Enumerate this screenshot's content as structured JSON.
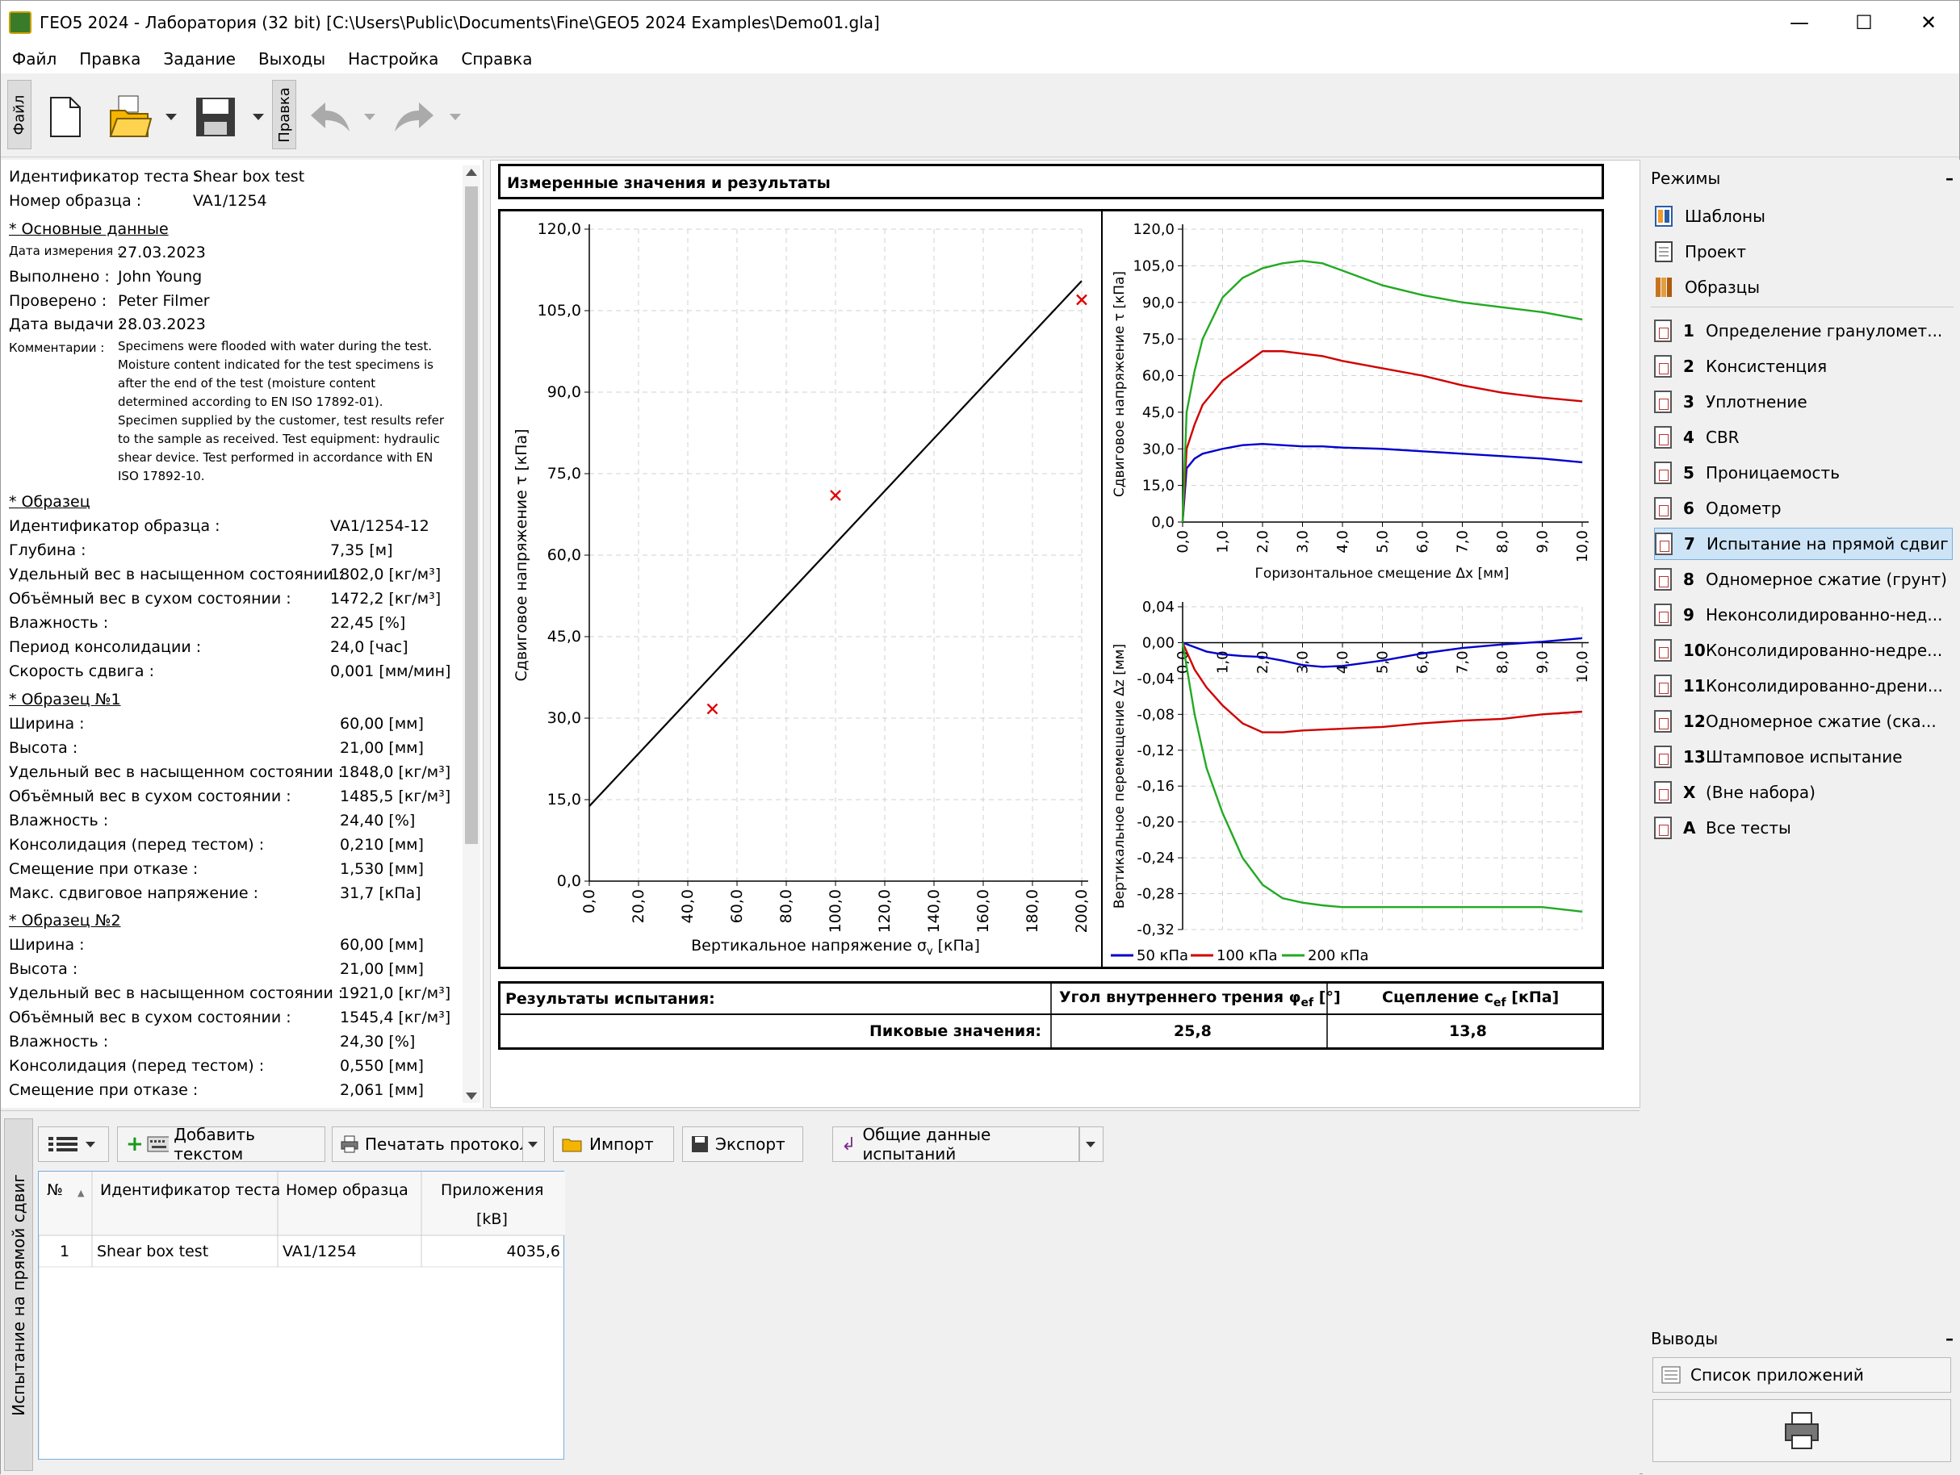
{
  "window": {
    "title": "ГЕО5 2024 - Лаборатория (32 bit) [C:\\Users\\Public\\Documents\\Fine\\GEO5 2024 Examples\\Demo01.gla]",
    "minimize": "—",
    "maximize": "☐",
    "close": "✕"
  },
  "menu": [
    "Файл",
    "Правка",
    "Задание",
    "Выходы",
    "Настройка",
    "Справка"
  ],
  "toolbar": {
    "tab_file": "Файл",
    "tab_edit": "Правка"
  },
  "left_panel": {
    "test_id_label": "Идентификатор теста :",
    "test_id_value": "Shear box test",
    "sample_no_label": "Номер образца :",
    "sample_no_value": "VA1/1254",
    "basic_section": "* Основные данные",
    "measure_date_label": "Дата измерения :",
    "measure_date_value": "27.03.2023",
    "performed_label": "Выполнено :",
    "performed_value": "John Young",
    "checked_label": "Проверено :",
    "checked_value": "Peter Filmer",
    "issue_date_label": "Дата выдачи :",
    "issue_date_value": "28.03.2023",
    "comments_label": "Комментарии :",
    "comments_lines": [
      "Specimens were flooded with water during the test.",
      "Moisture content indicated for the test specimens is",
      "after the end of the test (moisture content",
      "determined according to EN ISO 17892-01).",
      "Specimen supplied by the customer, test results refer",
      "to the sample as received. Test equipment: hydraulic",
      "shear device. Test performed in accordance with EN",
      "ISO 17892-10."
    ],
    "sample_section": "* Образец",
    "sample_rows": [
      {
        "label": "Идентификатор образца :",
        "value": "VA1/1254-12"
      },
      {
        "label": "Глубина :",
        "value": "7,35 [м]"
      },
      {
        "label": "Удельный вес в насыщенном состоянии :",
        "value": "1802,0 [кг/м³]"
      },
      {
        "label": "Объёмный вес в сухом состоянии :",
        "value": "1472,2 [кг/м³]"
      },
      {
        "label": "Влажность :",
        "value": "22,45 [%]"
      },
      {
        "label": "Период консолидации :",
        "value": "24,0 [час]"
      },
      {
        "label": "Скорость сдвига :",
        "value": "0,001 [мм/мин]"
      }
    ],
    "spec1_section": "* Образец №1",
    "spec1_rows": [
      {
        "label": "Ширина :",
        "value": "60,00 [мм]"
      },
      {
        "label": "Высота :",
        "value": "21,00 [мм]"
      },
      {
        "label": "Удельный вес в насыщенном состоянии :",
        "value": "1848,0 [кг/м³]"
      },
      {
        "label": "Объёмный вес в сухом состоянии :",
        "value": "1485,5 [кг/м³]"
      },
      {
        "label": "Влажность :",
        "value": "24,40 [%]"
      },
      {
        "label": "Консолидация (перед тестом) :",
        "value": "0,210 [мм]"
      },
      {
        "label": "Смещение при отказе :",
        "value": "1,530 [мм]"
      },
      {
        "label": "Макс. сдвиговое напряжение :",
        "value": "31,7 [кПа]"
      }
    ],
    "spec2_section": "* Образец №2",
    "spec2_rows": [
      {
        "label": "Ширина :",
        "value": "60,00 [мм]"
      },
      {
        "label": "Высота :",
        "value": "21,00 [мм]"
      },
      {
        "label": "Удельный вес в насыщенном состоянии :",
        "value": "1921,0 [кг/м³]"
      },
      {
        "label": "Объёмный вес в сухом состоянии :",
        "value": "1545,4 [кг/м³]"
      },
      {
        "label": "Влажность :",
        "value": "24,30 [%]"
      },
      {
        "label": "Консолидация (перед тестом) :",
        "value": "0,550 [мм]"
      },
      {
        "label": "Смещение при отказе :",
        "value": "2,061 [мм]"
      }
    ]
  },
  "center": {
    "header": "Измеренные значения и результаты",
    "results": {
      "title": "Результаты испытания:",
      "phi_label": "Угол внутреннего трения φ",
      "phi_sub": "ef",
      "phi_unit": " [°]",
      "c_label": "Сцепление c",
      "c_sub": "ef",
      "c_unit": " [кПа]",
      "peak_label": "Пиковые значения:",
      "phi_value": "25,8",
      "c_value": "13,8"
    }
  },
  "chart_data": [
    {
      "type": "scatter",
      "xlabel": "Вертикальное напряжение σ",
      "xlabel_sub": "v",
      "xlabel_unit": " [кПа]",
      "ylabel": "Сдвиговое напряжение τ [кПа]",
      "xlim": [
        0,
        200
      ],
      "ylim": [
        0,
        120
      ],
      "x_ticks": [
        "0,0",
        "20,0",
        "40,0",
        "60,0",
        "80,0",
        "100,0",
        "120,0",
        "140,0",
        "160,0",
        "180,0",
        "200,0"
      ],
      "y_ticks": [
        "0,0",
        "15,0",
        "30,0",
        "45,0",
        "60,0",
        "75,0",
        "90,0",
        "105,0",
        "120,0"
      ],
      "points": [
        {
          "x": 50,
          "y": 31.7
        },
        {
          "x": 100,
          "y": 71
        },
        {
          "x": 200,
          "y": 107
        }
      ],
      "fit_line": {
        "c": 13.8,
        "phi": 25.8
      },
      "marker_color": "#e00000",
      "line_color": "#000000"
    },
    {
      "type": "line",
      "xlabel": "Горизонтальное смещение Δx [мм]",
      "ylabel": "Сдвиговое напряжение τ [кПа]",
      "xlim": [
        0,
        10
      ],
      "ylim": [
        0,
        120
      ],
      "x_ticks": [
        "0,0",
        "1,0",
        "2,0",
        "3,0",
        "4,0",
        "5,0",
        "6,0",
        "7,0",
        "8,0",
        "9,0",
        "10,0"
      ],
      "y_ticks": [
        "0,0",
        "15,0",
        "30,0",
        "45,0",
        "60,0",
        "75,0",
        "90,0",
        "105,0",
        "120,0"
      ],
      "x": [
        0,
        0.1,
        0.3,
        0.5,
        1,
        1.5,
        2,
        2.5,
        3,
        3.5,
        4,
        5,
        6,
        7,
        8,
        9,
        10
      ],
      "series": [
        {
          "name": "50 кПа",
          "color": "#0000cc",
          "values": [
            0,
            22,
            26,
            28,
            30,
            31.5,
            32,
            31.5,
            31,
            31,
            30.5,
            30,
            29,
            28,
            27,
            26,
            24.5
          ]
        },
        {
          "name": "100 кПа",
          "color": "#d00000",
          "values": [
            0,
            30,
            40,
            48,
            58,
            64,
            70,
            70,
            69,
            68,
            66,
            63,
            60,
            56,
            53,
            51,
            49.5
          ]
        },
        {
          "name": "200 кПа",
          "color": "#22aa22",
          "values": [
            0,
            45,
            62,
            75,
            92,
            100,
            104,
            106,
            107,
            106,
            103,
            97,
            93,
            90,
            88,
            86,
            83
          ]
        }
      ]
    },
    {
      "type": "line",
      "xlabel": "",
      "ylabel": "Вертикальное перемещение Δz [мм]",
      "xlim": [
        0,
        10
      ],
      "ylim": [
        -0.32,
        0.04
      ],
      "x_ticks": [
        "0,0",
        "1,0",
        "2,0",
        "3,0",
        "4,0",
        "5,0",
        "6,0",
        "7,0",
        "8,0",
        "9,0",
        "10,0"
      ],
      "y_ticks": [
        "0,04",
        "0,00",
        "-0,04",
        "-0,08",
        "-0,12",
        "-0,16",
        "-0,20",
        "-0,24",
        "-0,28",
        "-0,32"
      ],
      "x": [
        0,
        0.3,
        0.6,
        1,
        1.5,
        2,
        2.5,
        3,
        3.5,
        4,
        5,
        6,
        7,
        8,
        9,
        10
      ],
      "series": [
        {
          "name": "50 кПа",
          "color": "#0000cc",
          "values": [
            0,
            -0.005,
            -0.01,
            -0.013,
            -0.015,
            -0.016,
            -0.02,
            -0.025,
            -0.027,
            -0.026,
            -0.02,
            -0.012,
            -0.006,
            -0.002,
            0.001,
            0.005
          ]
        },
        {
          "name": "100 кПа",
          "color": "#d00000",
          "values": [
            0,
            -0.03,
            -0.05,
            -0.07,
            -0.09,
            -0.1,
            -0.1,
            -0.098,
            -0.097,
            -0.096,
            -0.094,
            -0.09,
            -0.087,
            -0.085,
            -0.08,
            -0.077
          ]
        },
        {
          "name": "200 кПа",
          "color": "#22aa22",
          "values": [
            0,
            -0.08,
            -0.14,
            -0.19,
            -0.24,
            -0.27,
            -0.285,
            -0.29,
            -0.293,
            -0.295,
            -0.295,
            -0.295,
            -0.295,
            -0.295,
            -0.295,
            -0.3
          ]
        }
      ],
      "legend": [
        "50 кПа",
        "100 кПа",
        "200 кПа"
      ]
    }
  ],
  "right_panel": {
    "modes_title": "Режимы",
    "collapse": "–",
    "top_items": [
      "Шаблоны",
      "Проект",
      "Образцы"
    ],
    "tests": [
      {
        "num": "1",
        "label": "Определение грануломет..."
      },
      {
        "num": "2",
        "label": "Консистенция"
      },
      {
        "num": "3",
        "label": "Уплотнение"
      },
      {
        "num": "4",
        "label": "CBR"
      },
      {
        "num": "5",
        "label": "Проницаемость"
      },
      {
        "num": "6",
        "label": "Одометр"
      },
      {
        "num": "7",
        "label": "Испытание на прямой сдвиг"
      },
      {
        "num": "8",
        "label": "Одномерное сжатие (грунт)"
      },
      {
        "num": "9",
        "label": "Неконсолидированно-нед..."
      },
      {
        "num": "10",
        "label": "Консолидированно-недре..."
      },
      {
        "num": "11",
        "label": "Консолидированно-дрени..."
      },
      {
        "num": "12",
        "label": "Одномерное сжатие (ска..."
      },
      {
        "num": "13",
        "label": "Штамповое испытание"
      },
      {
        "num": "X",
        "label": "(Вне набора)"
      },
      {
        "num": "A",
        "label": "Все тесты"
      }
    ],
    "outputs_title": "Выводы",
    "attachments_btn": "Список приложений"
  },
  "bottom": {
    "vtab": "Испытание на прямой сдвиг",
    "add_text_btn": "Добавить текстом",
    "print_btn": "Печатать протокол",
    "import_btn": "Импорт",
    "export_btn": "Экспорт",
    "common_btn": "Общие данные испытаний",
    "table": {
      "headers": [
        "№",
        "Идентификатор теста",
        "Номер образца",
        "Приложения",
        "[kB]"
      ],
      "rows": [
        [
          "1",
          "Shear box test",
          "VA1/1254",
          "4035,6"
        ]
      ]
    }
  }
}
